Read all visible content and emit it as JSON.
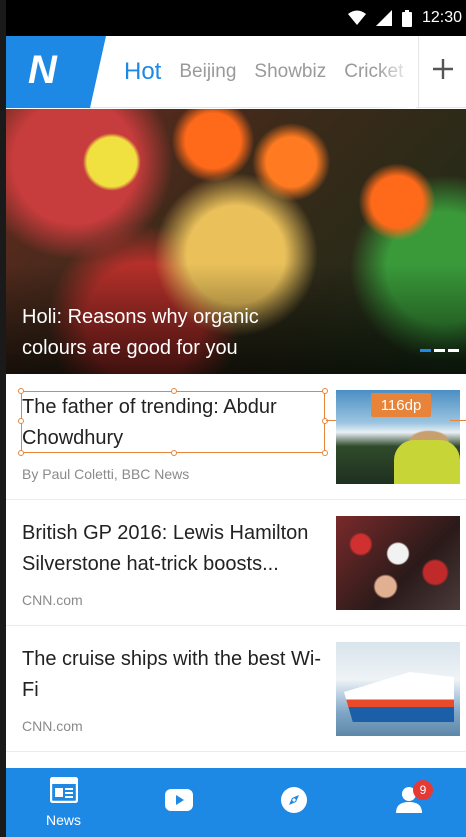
{
  "status_bar": {
    "time": "12:30"
  },
  "header": {
    "logo_letter": "N",
    "tabs": [
      {
        "label": "Hot",
        "active": true
      },
      {
        "label": "Beijing",
        "active": false
      },
      {
        "label": "Showbiz",
        "active": false
      },
      {
        "label": "Cricket",
        "active": false
      }
    ]
  },
  "hero": {
    "title": "Holi: Reasons why organic colours are good for you",
    "slide_count": 3,
    "active_slide": 1
  },
  "news": [
    {
      "title": "The father of trending: Abdur Chowdhury",
      "source": "By Paul Coletti, BBC News"
    },
    {
      "title": "British GP 2016: Lewis Hamilton Silverstone hat-trick boosts...",
      "source": "CNN.com"
    },
    {
      "title": "The cruise ships with the best Wi-Fi",
      "source": "CNN.com"
    }
  ],
  "annotation": {
    "dimension": "116dp"
  },
  "bottom_nav": {
    "items": [
      {
        "label": "News",
        "icon": "newspaper-icon"
      },
      {
        "label": "",
        "icon": "video-play-icon"
      },
      {
        "label": "",
        "icon": "compass-icon"
      },
      {
        "label": "",
        "icon": "profile-icon",
        "badge": "9"
      }
    ]
  },
  "colors": {
    "accent": "#1e88e5",
    "annotation": "#e8833a",
    "badge": "#e53935"
  }
}
